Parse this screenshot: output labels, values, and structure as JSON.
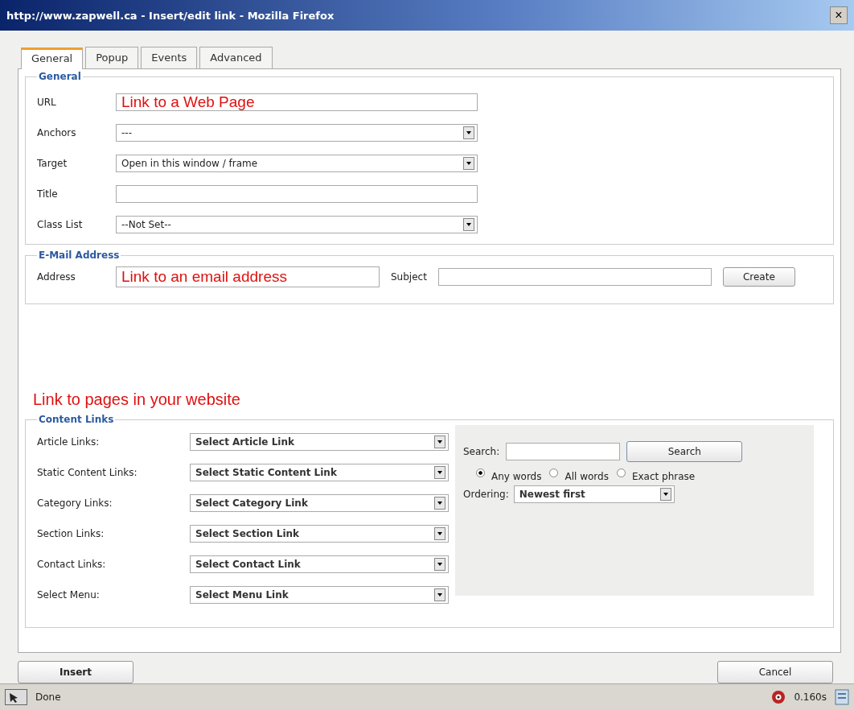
{
  "window": {
    "title": "http://www.zapwell.ca - Insert/edit link - Mozilla Firefox",
    "close": "×"
  },
  "tabs": [
    {
      "label": "General",
      "selected": true
    },
    {
      "label": "Popup",
      "selected": false
    },
    {
      "label": "Events",
      "selected": false
    },
    {
      "label": "Advanced",
      "selected": false
    }
  ],
  "general": {
    "legend": "General",
    "fields": [
      {
        "label": "URL",
        "kind": "text",
        "value": "Link to a Web Page",
        "annotation": true
      },
      {
        "label": "Anchors",
        "kind": "select",
        "value": "---"
      },
      {
        "label": "Target",
        "kind": "select",
        "value": "Open in this window / frame"
      },
      {
        "label": "Title",
        "kind": "text"
      },
      {
        "label": "Class List",
        "kind": "select",
        "value": "--Not Set--"
      }
    ]
  },
  "email": {
    "legend": "E-Mail Address",
    "address_label": "Address",
    "address_value": "Link to an email address",
    "subject_label": "Subject",
    "create": "Create"
  },
  "note": "Link to pages in your website",
  "content_links": {
    "legend": "Content Links",
    "rows": [
      {
        "label": "Article Links:",
        "value": "Select Article Link"
      },
      {
        "label": "Static Content Links:",
        "value": "Select Static Content Link"
      },
      {
        "label": "Category Links:",
        "value": "Select Category Link"
      },
      {
        "label": "Section Links:",
        "value": "Select Section Link"
      },
      {
        "label": "Contact Links:",
        "value": "Select Contact Link"
      },
      {
        "label": "Select Menu:",
        "value": "Select Menu Link"
      }
    ],
    "search": {
      "label": "Search:",
      "button": "Search",
      "options": [
        {
          "label": "Any words",
          "selected": true
        },
        {
          "label": "All words",
          "selected": false
        },
        {
          "label": "Exact phrase",
          "selected": false
        }
      ],
      "ordering_label": "Ordering:",
      "ordering_value": "Newest first"
    }
  },
  "buttons": {
    "insert": "Insert",
    "cancel": "Cancel"
  },
  "status_bar": {
    "text": "Done",
    "time": "0.160s"
  }
}
